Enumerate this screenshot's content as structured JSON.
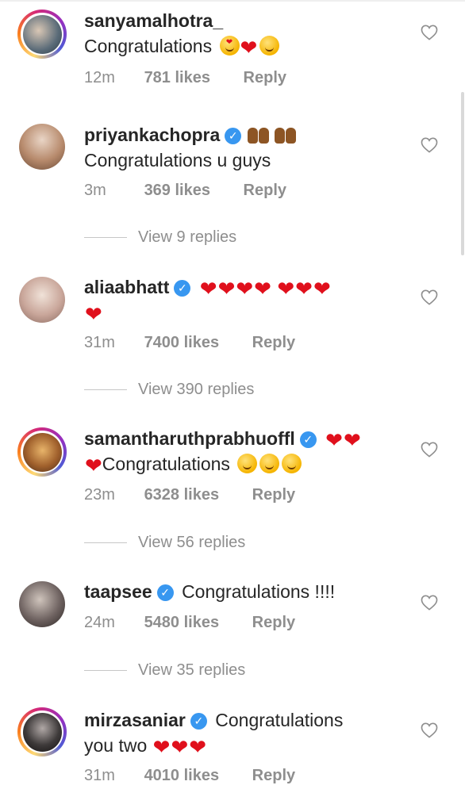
{
  "comments": [
    {
      "username": "sanyamalhotra_",
      "verified": false,
      "story_ring": true,
      "text_line1": "Congratulations",
      "text_line2": "",
      "emojis": [
        "heart-eyes",
        "heart",
        "party-face"
      ],
      "time": "12m",
      "likes": "781 likes",
      "reply": "Reply"
    },
    {
      "username": "priyankachopra",
      "verified": true,
      "story_ring": false,
      "text_line1": "",
      "text_line2": "Congratulations u guys",
      "emojis": [
        "raising-hands",
        "raising-hands"
      ],
      "time": "3m",
      "likes": "369 likes",
      "reply": "Reply",
      "view_replies": "View 9 replies"
    },
    {
      "username": "aliaabhatt",
      "verified": true,
      "story_ring": false,
      "text_line1": "",
      "text_line2": "",
      "emojis": [
        "heart",
        "heart",
        "heart",
        "heart",
        "heart",
        "heart",
        "heart",
        "heart"
      ],
      "time": "31m",
      "likes": "7400 likes",
      "reply": "Reply",
      "view_replies": "View 390 replies"
    },
    {
      "username": "samantharuthprabhuoffl",
      "verified": true,
      "story_ring": true,
      "text_line1": "",
      "text_line2": "Congratulations",
      "emojis": [
        "heart",
        "heart",
        "heart",
        "hugging-face",
        "hugging-face",
        "hugging-face"
      ],
      "time": "23m",
      "likes": "6328 likes",
      "reply": "Reply",
      "view_replies": "View 56 replies"
    },
    {
      "username": "taapsee",
      "verified": true,
      "story_ring": false,
      "text_line1": "Congratulations !!!!",
      "text_line2": "",
      "emojis": [],
      "time": "24m",
      "likes": "5480 likes",
      "reply": "Reply",
      "view_replies": "View 35 replies"
    },
    {
      "username": "mirzasaniar",
      "verified": true,
      "story_ring": true,
      "text_line1": "Congratulations",
      "text_line2": "you two",
      "emojis": [
        "heart",
        "heart",
        "heart"
      ],
      "time": "31m",
      "likes": "4010 likes",
      "reply": "Reply"
    }
  ],
  "verified_glyph": "✓",
  "heart_glyph": "❤",
  "icons": {
    "like": "heart-outline-icon",
    "verified": "verified-badge-icon"
  },
  "colors": {
    "text": "#262626",
    "muted": "#8e8e8e",
    "verified_blue": "#3897f0",
    "heart_red": "#e0101c"
  }
}
